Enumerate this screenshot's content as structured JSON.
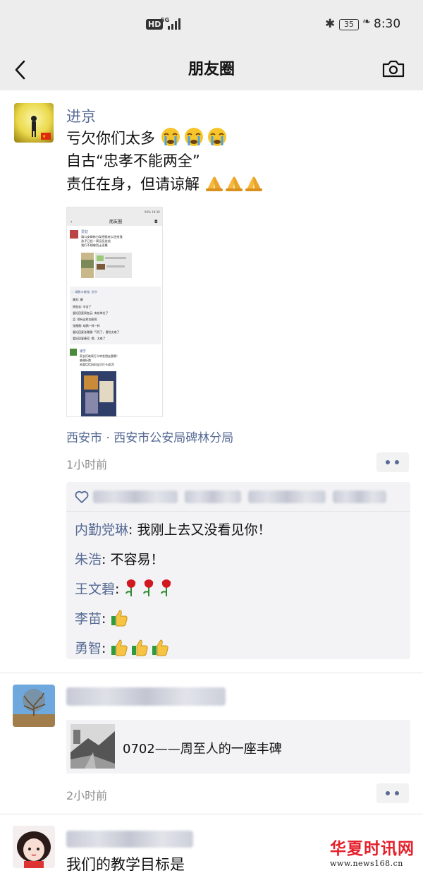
{
  "status_bar": {
    "hd": "HD",
    "network": "5G",
    "battery": "35",
    "time": "8:30"
  },
  "nav": {
    "title": "朋友圈",
    "back_icon": "chevron-left-icon",
    "camera_icon": "camera-icon"
  },
  "post1": {
    "author": "进京",
    "lines": [
      "亏欠你们太多",
      "自古“忠孝不能两全”",
      "责任在身，但请谅解"
    ],
    "location": "西安市 · 西安市公安局碑林分局",
    "time": "1小时前",
    "comments": [
      {
        "name": "内勤党琳",
        "text": "我刚上去又没看见你！"
      },
      {
        "name": "朱浩",
        "text": "不容易！"
      },
      {
        "name": "王文碧",
        "text": ""
      },
      {
        "name": "李苗",
        "text": ""
      },
      {
        "name": "勇智",
        "text": ""
      }
    ]
  },
  "embedded_screenshot": {
    "title": "朋友圈",
    "status": "94% 19:39",
    "post_author": "爱妃",
    "post_lines": [
      "请公安碑林分局把我老公还给我",
      "孩子已经一周没见爸爸",
      "我们不想做烈士家属"
    ],
    "likes": "♡ 嫣鹏丰敬雅, 进京",
    "comments": [
      "康芳: 唰",
      "周玺云: 辛苦了",
      "爱妃回复周玺云: 卖给单位了",
      "品: 那有这样加班呢",
      "张雅雅: 咱俩一样一样",
      "爱妃回复张雅雅: 气死了，冒险太难了",
      "爱妃回复康芳: 嗯，太难了"
    ],
    "second_author": "康芳",
    "second_lines": [
      "家长们继续打卡转发朋友圈哦！",
      "感谢拆跑",
      "恭喜恬恬妈妈宝贝打卡成功!"
    ]
  },
  "post2": {
    "share_title": "0702——周至人的一座丰碑",
    "time": "2小时前"
  },
  "post3": {
    "text": "我们的教学目标是"
  },
  "watermark": {
    "title": "华夏时讯网",
    "url": "www.news168.cn"
  },
  "colors": {
    "link": "#576b95",
    "background_bar": "#ededed",
    "comment_bg": "#f3f3f5",
    "watermark_red": "#e5202b"
  }
}
